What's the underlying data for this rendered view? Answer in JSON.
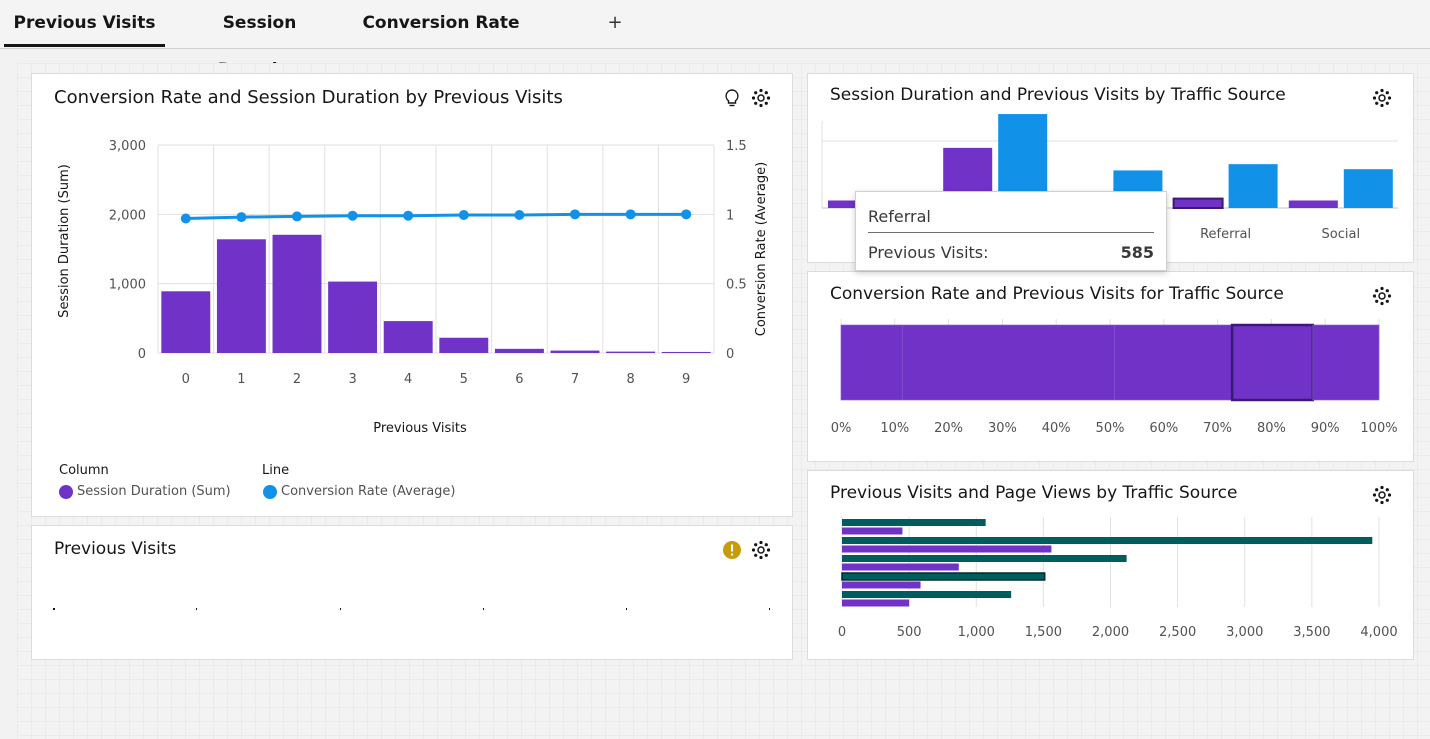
{
  "tabs": [
    {
      "label": "Previous Visits",
      "active": true
    },
    {
      "label": "Session Duration",
      "active": false
    },
    {
      "label": "Conversion Rate",
      "active": false
    }
  ],
  "tab_add_symbol": "+",
  "colors": {
    "purple": "#7132c8",
    "blue": "#1192e8",
    "teal": "#005d5d",
    "warning": "#c89b0a"
  },
  "card_main": {
    "title": "Conversion Rate and Session Duration by Previous Visits",
    "icons": [
      "lightbulb-icon",
      "settings-icon"
    ],
    "legend": {
      "column_heading": "Column",
      "column_item": "Session Duration (Sum)",
      "line_heading": "Line",
      "line_item": "Conversion Rate (Average)"
    }
  },
  "card_prev_visits": {
    "title": "Previous Visits",
    "icons": [
      "warning-icon",
      "settings-icon"
    ]
  },
  "card_traffic": {
    "title": "Session Duration and Previous Visits by Traffic Source",
    "icons": [
      "settings-icon"
    ],
    "tooltip": {
      "title": "Referral",
      "label": "Previous Visits:",
      "value": "585"
    }
  },
  "card_conv_traffic": {
    "title": "Conversion Rate and Previous Visits for Traffic Source",
    "icons": [
      "settings-icon"
    ]
  },
  "card_pageviews": {
    "title": "Previous Visits and Page Views by Traffic Source",
    "icons": [
      "settings-icon"
    ]
  },
  "chart_data": [
    {
      "type": "bar+line",
      "title": "Conversion Rate and Session Duration by Previous Visits",
      "xlabel": "Previous Visits",
      "ylabel": "Session Duration (Sum)",
      "y2label": "Conversion Rate (Average)",
      "categories": [
        "0",
        "1",
        "2",
        "3",
        "4",
        "5",
        "6",
        "7",
        "8",
        "9"
      ],
      "ylim": [
        0,
        3000
      ],
      "y_ticks": [
        "3,000",
        "2,000",
        "1,000",
        "0"
      ],
      "y_tick_values": [
        3000,
        2000,
        1000,
        0
      ],
      "y2lim": [
        0,
        1.5
      ],
      "y2_ticks": [
        "1.5",
        "1",
        "0.5",
        "0"
      ],
      "y2_tick_values": [
        1.5,
        1,
        0.5,
        0
      ],
      "series": [
        {
          "name": "Session Duration (Sum)",
          "kind": "column",
          "values": [
            890,
            1640,
            1705,
            1030,
            460,
            220,
            60,
            35,
            20,
            15
          ]
        },
        {
          "name": "Conversion Rate (Average)",
          "kind": "line",
          "values": [
            0.97,
            0.98,
            0.985,
            0.99,
            0.99,
            0.995,
            0.995,
            1.0,
            1.0,
            1.0
          ]
        }
      ],
      "grid": true
    },
    {
      "type": "bar",
      "title": "Session Duration and Previous Visits by Traffic Source",
      "categories": [
        "",
        "",
        "",
        "Referral",
        "Social"
      ],
      "series": [
        {
          "values": [
            120,
            960,
            190,
            150,
            120
          ]
        },
        {
          "values": [
            40,
            1500,
            600,
            700,
            620
          ]
        }
      ],
      "ylim": [
        0,
        1900
      ],
      "grid": true
    },
    {
      "type": "stacked-bar-100",
      "title": "Conversion Rate and Previous Visits for Traffic Source",
      "x_ticks": [
        "0%",
        "10%",
        "20%",
        "30%",
        "40%",
        "50%",
        "60%",
        "70%",
        "80%",
        "90%",
        "100%"
      ],
      "segments": [
        11.4,
        39.4,
        21.9,
        15.0,
        12.3
      ],
      "highlighted_segment": 3
    },
    {
      "type": "bar",
      "orientation": "horizontal",
      "title": "Previous Visits and Page Views by Traffic Source",
      "x_ticks": [
        "0",
        "500",
        "1,000",
        "1,500",
        "2,000",
        "2,500",
        "3,000",
        "3,500",
        "4,000"
      ],
      "xlim": [
        0,
        4000
      ],
      "rows": [
        {
          "teal": 1070,
          "purple": 450
        },
        {
          "teal": 3950,
          "purple": 1560
        },
        {
          "teal": 2120,
          "purple": 870
        },
        {
          "teal": 1510,
          "purple": 585
        },
        {
          "teal": 1260,
          "purple": 500
        }
      ]
    }
  ]
}
